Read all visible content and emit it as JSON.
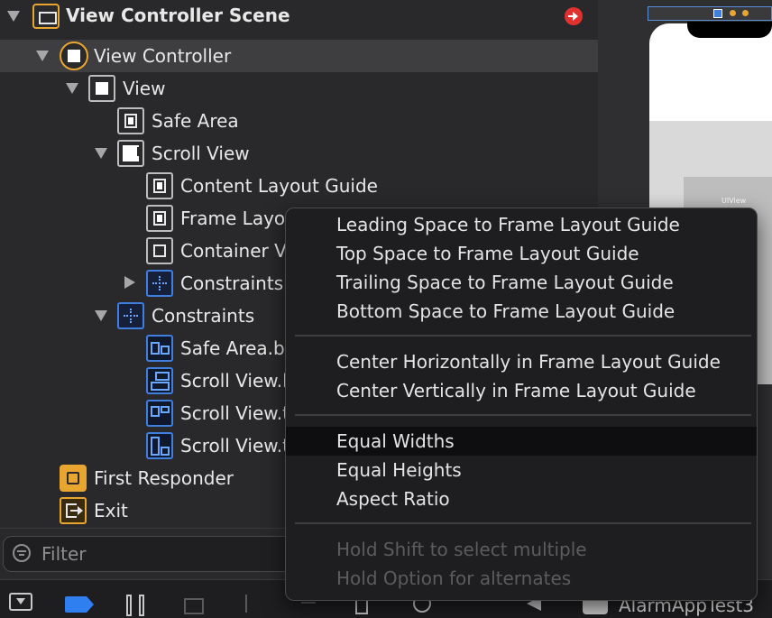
{
  "navigator": {
    "rows": [
      {
        "label": "View Controller Scene"
      },
      {
        "label": "View Controller"
      },
      {
        "label": "View"
      },
      {
        "label": "Safe Area"
      },
      {
        "label": "Scroll View"
      },
      {
        "label": "Content Layout Guide"
      },
      {
        "label": "Frame Layout Guide"
      },
      {
        "label": "Container View"
      },
      {
        "label": "Constraints"
      },
      {
        "label": "Constraints"
      },
      {
        "label": "Safe Area.bottom"
      },
      {
        "label": "Scroll View.leading"
      },
      {
        "label": "Scroll View.trailing"
      },
      {
        "label": "Scroll View.top"
      },
      {
        "label": "First Responder"
      },
      {
        "label": "Exit"
      }
    ],
    "filter_placeholder": "Filter"
  },
  "canvas": {
    "uiview_label": "UIView"
  },
  "toolbar": {
    "project_name": "AlarmAppTest3"
  },
  "context_menu": {
    "group1": [
      "Leading Space to Frame Layout Guide",
      "Top Space to Frame Layout Guide",
      "Trailing Space to Frame Layout Guide",
      "Bottom Space to Frame Layout Guide"
    ],
    "group2": [
      "Center Horizontally in Frame Layout Guide",
      "Center Vertically in Frame Layout Guide"
    ],
    "group3": [
      "Equal Widths",
      "Equal Heights",
      "Aspect Ratio"
    ],
    "hints": [
      "Hold Shift to select multiple",
      "Hold Option for alternates"
    ]
  },
  "colors": {
    "accent": "#3e7fe0",
    "warning": "#e0312f",
    "controller_icon": "#e8a530"
  }
}
